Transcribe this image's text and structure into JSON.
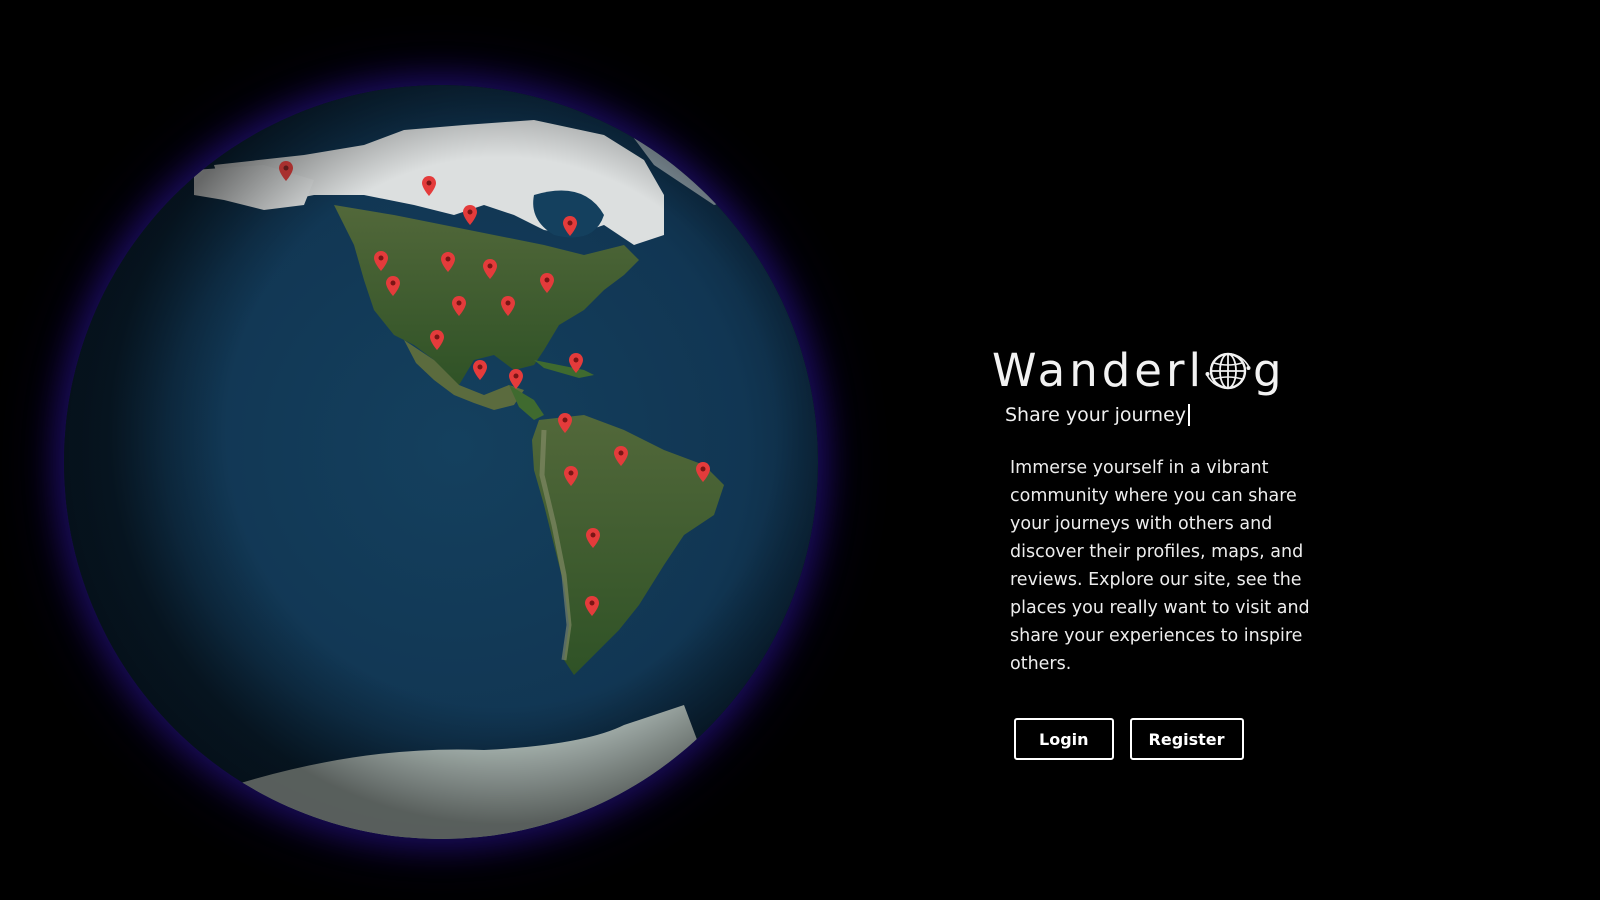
{
  "brand": {
    "logo_prefix": "Wanderl",
    "logo_suffix": "g",
    "logo_icon": "globe-icon",
    "tagline": "Share your journey"
  },
  "description": "Immerse yourself in a vibrant community where you can share your journeys with others and discover their profiles, maps, and reviews. Explore our site, see the places you really want to visit and share your experiences to inspire others.",
  "actions": {
    "login_label": "Login",
    "register_label": "Register"
  },
  "globe": {
    "pin_icon": "map-pin-icon",
    "pin_count": 22
  },
  "colors": {
    "background": "#000000",
    "ocean": "#123a55",
    "land": "#3c5a2c",
    "ice": "#dfe3e3",
    "pin": "#e43b3b",
    "glow": "#2a148c",
    "text": "#ffffff"
  }
}
